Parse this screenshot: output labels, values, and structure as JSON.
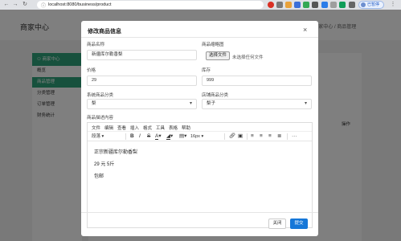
{
  "browser": {
    "url": "localhost:8080/business/product",
    "profile_label": "已暂停",
    "back_icon": "back-arrow-icon",
    "forward_icon": "forward-arrow-icon",
    "reload_icon": "reload-icon",
    "lock_icon": "info-icon"
  },
  "background_page": {
    "brand": "商家中心",
    "breadcrumb": "⌂ 商家中心 / 商品管理",
    "sidebar": {
      "header": "⚇ 商家中心",
      "items": [
        {
          "label": "商品管理",
          "active": true
        },
        {
          "label": "分类管理",
          "active": false
        },
        {
          "label": "订单管理",
          "active": false
        },
        {
          "label": "财务统计",
          "active": false
        }
      ],
      "first_item": "概览"
    },
    "table_header": "操作"
  },
  "modal": {
    "title": "修改商品信息",
    "close": "×",
    "fields": {
      "name": {
        "label": "商品名称",
        "value": "新疆库尔勒香梨"
      },
      "thumbnail": {
        "label": "商品缩略图",
        "button": "选择文件",
        "status": "未选择任何文件"
      },
      "price": {
        "label": "价格",
        "value": "29"
      },
      "stock": {
        "label": "库存",
        "value": "999"
      },
      "system_category": {
        "label": "系统商品分类",
        "value": "梨"
      },
      "shop_category": {
        "label": "店铺商品分类",
        "value": "梨子"
      },
      "description": {
        "label": "商品描述内容"
      }
    },
    "editor": {
      "menu": [
        "文件",
        "编辑",
        "查看",
        "插入",
        "格式",
        "工具",
        "表格",
        "帮助"
      ],
      "block_format": "段落",
      "font_size": "16px",
      "content": [
        "正宗新疆库尔勒香梨",
        "29 元 5斤",
        "包邮"
      ]
    },
    "buttons": {
      "cancel": "关闭",
      "submit": "提交"
    }
  },
  "colors": {
    "accent": "#2fa37a",
    "primary_button": "#1677d8"
  }
}
